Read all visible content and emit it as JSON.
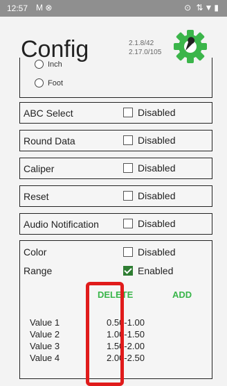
{
  "status": {
    "time": "12:57",
    "left_icons": "M ⊗",
    "right_icons": "⊙ ⇅▼▮"
  },
  "header": {
    "title": "Config",
    "version_line1": "2.1.8/42",
    "version_line2": "2.17.0/105",
    "gear_color": "#3bb54a"
  },
  "units": {
    "inch": "Inch",
    "foot": "Foot"
  },
  "rows": [
    {
      "label": "ABC Select",
      "status": "Disabled"
    },
    {
      "label": "Round Data",
      "status": "Disabled"
    },
    {
      "label": "Caliper",
      "status": "Disabled"
    },
    {
      "label": "Reset",
      "status": "Disabled"
    },
    {
      "label": "Audio Notification",
      "status": "Disabled"
    }
  ],
  "panel": {
    "color_label": "Color",
    "color_status": "Disabled",
    "range_label": "Range",
    "range_status": "Enabled",
    "delete_label": "DELETE",
    "add_label": "ADD",
    "values": [
      {
        "name": "Value 1",
        "range": "0.50-1.00"
      },
      {
        "name": "Value 2",
        "range": "1.00-1.50"
      },
      {
        "name": "Value 3",
        "range": "1.50-2.00"
      },
      {
        "name": "Value 4",
        "range": "2.00-2.50"
      }
    ]
  }
}
